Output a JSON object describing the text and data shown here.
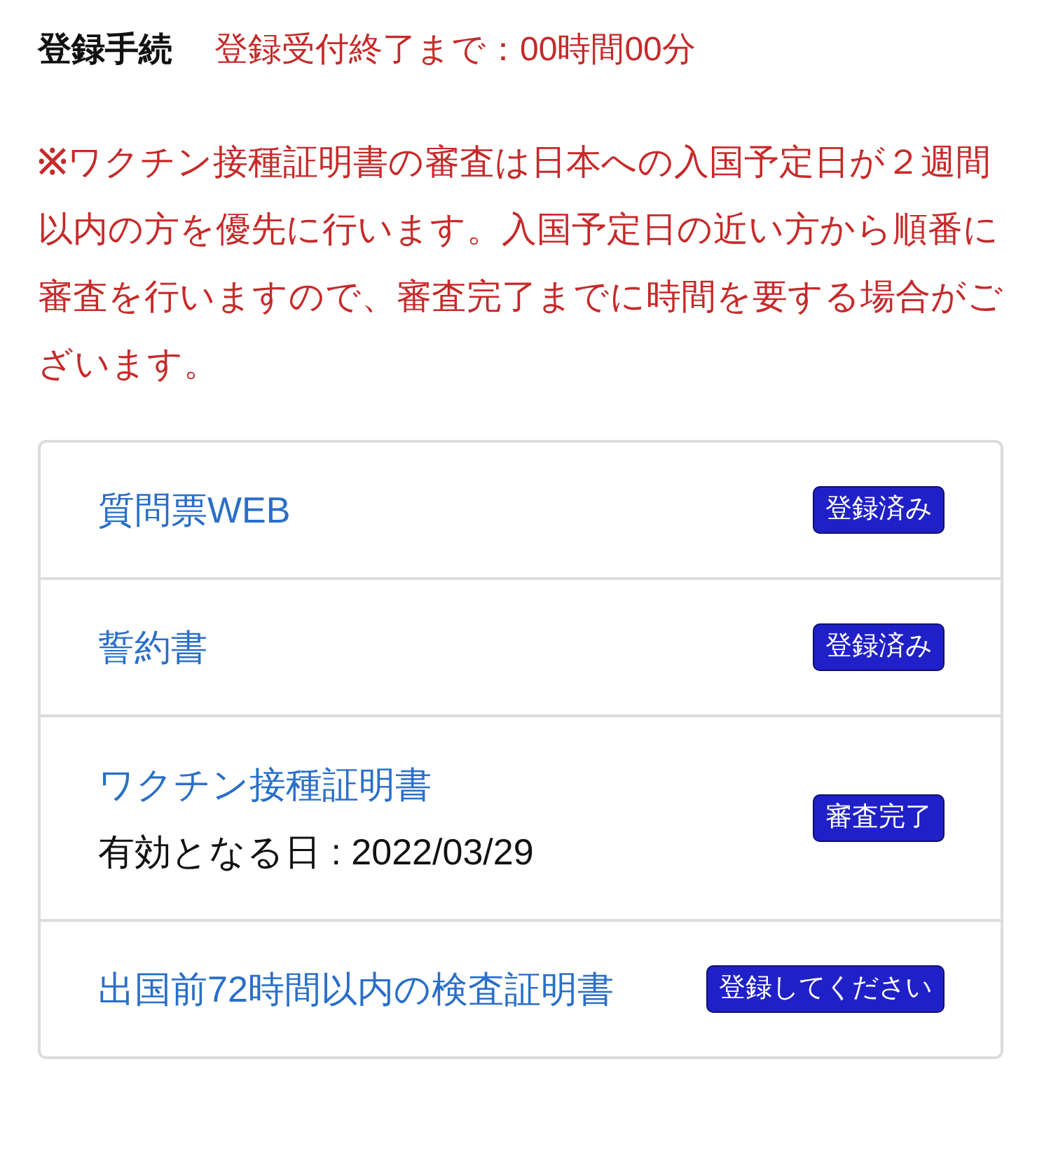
{
  "header": {
    "title": "登録手続",
    "deadline": "登録受付終了まで：00時間00分"
  },
  "notice": "**※**ワクチン接種証明書の審査は日本への入国予定日が２週間以内の方を優先に行います。入国予定日の近い方から順番に審査を行いますので、審査完了までに時間を要する場合がございます。",
  "items": [
    {
      "link": "質問票WEB",
      "status": "登録済み"
    },
    {
      "link": "誓約書",
      "status": "登録済み"
    },
    {
      "link": "ワクチン接種証明書",
      "detail": "有効となる日 : 2022/03/29",
      "status": "審査完了"
    },
    {
      "link": "出国前72時間以内の検査証明書",
      "status": "登録してください"
    }
  ]
}
